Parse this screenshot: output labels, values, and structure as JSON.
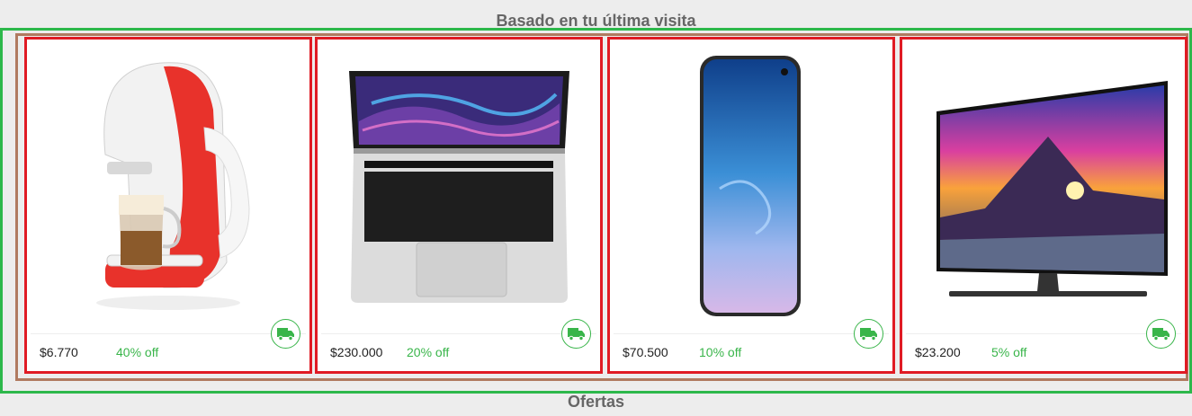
{
  "sections": {
    "top_title": "Basado en tu última visita",
    "bottom_title": "Ofertas"
  },
  "colors": {
    "frame_outer": "#2db84b",
    "frame_inner": "#b07a60",
    "card_border": "#e01b24",
    "discount": "#39b54a"
  },
  "products": [
    {
      "image_icon": "coffee-machine-image",
      "price": "$6.770",
      "discount": "40% off",
      "shipping_icon": "truck-icon"
    },
    {
      "image_icon": "laptop-image",
      "price": "$230.000",
      "discount": "20% off",
      "shipping_icon": "truck-icon"
    },
    {
      "image_icon": "smartphone-image",
      "price": "$70.500",
      "discount": "10% off",
      "shipping_icon": "truck-icon"
    },
    {
      "image_icon": "television-image",
      "price": "$23.200",
      "discount": "5% off",
      "shipping_icon": "truck-icon"
    }
  ]
}
